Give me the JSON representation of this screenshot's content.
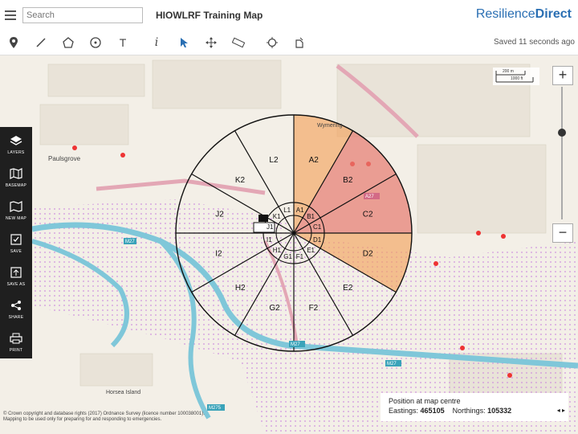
{
  "header": {
    "search_placeholder": "Search",
    "title": "HIOWLRF Training Map",
    "brand_part1": "Resilience",
    "brand_part2": "Direct",
    "saved_text": "Saved 11 seconds ago"
  },
  "toolbar": {
    "tools": [
      "marker-icon",
      "line-icon",
      "polygon-icon",
      "circle-icon",
      "text-icon",
      "info-icon",
      "select-icon",
      "move-icon",
      "measure-icon",
      "locate-icon",
      "export-icon"
    ]
  },
  "sidebar": {
    "items": [
      {
        "label": "LAYERS",
        "icon": "layers-icon"
      },
      {
        "label": "BASEMAP",
        "icon": "basemap-icon"
      },
      {
        "label": "NEW MAP",
        "icon": "new-map-icon"
      },
      {
        "label": "SAVE",
        "icon": "save-icon"
      },
      {
        "label": "SAVE AS",
        "icon": "save-as-icon"
      },
      {
        "label": "SHARE",
        "icon": "share-icon"
      },
      {
        "label": "PRINT",
        "icon": "print-icon"
      }
    ]
  },
  "map": {
    "sectors_outer": [
      "A2",
      "B2",
      "C2",
      "D2",
      "E2",
      "F2",
      "G2",
      "H2",
      "I2",
      "J2",
      "K2",
      "L2"
    ],
    "sectors_inner": [
      "A1",
      "B1",
      "C1",
      "D1",
      "E1",
      "F1",
      "G1",
      "H1",
      "I1",
      "J1",
      "K1",
      "L1"
    ],
    "place_labels": [
      "Paulsgrove",
      "Horsea Island",
      "Wymering",
      "M27",
      "M275",
      "A27"
    ],
    "scale_labels": [
      "200 m",
      "1000 ft"
    ],
    "zoom_in": "+",
    "zoom_out": "−",
    "colors": {
      "orange": "#f2a35e",
      "red": "#e67a6f",
      "water": "#7fc7d9",
      "dots": "#cc88dd"
    }
  },
  "position": {
    "heading": "Position at map centre",
    "eastings_label": "Eastings:",
    "eastings_value": "465105",
    "northings_label": "Northings:",
    "northings_value": "105332",
    "toggle": "◂ ▸"
  },
  "copyright": {
    "line1": "© Crown copyright and database rights (2017) Ordnance Survey (licence number 100038001).",
    "line2": "Mapping to be used only for preparing for and responding to emergencies."
  }
}
